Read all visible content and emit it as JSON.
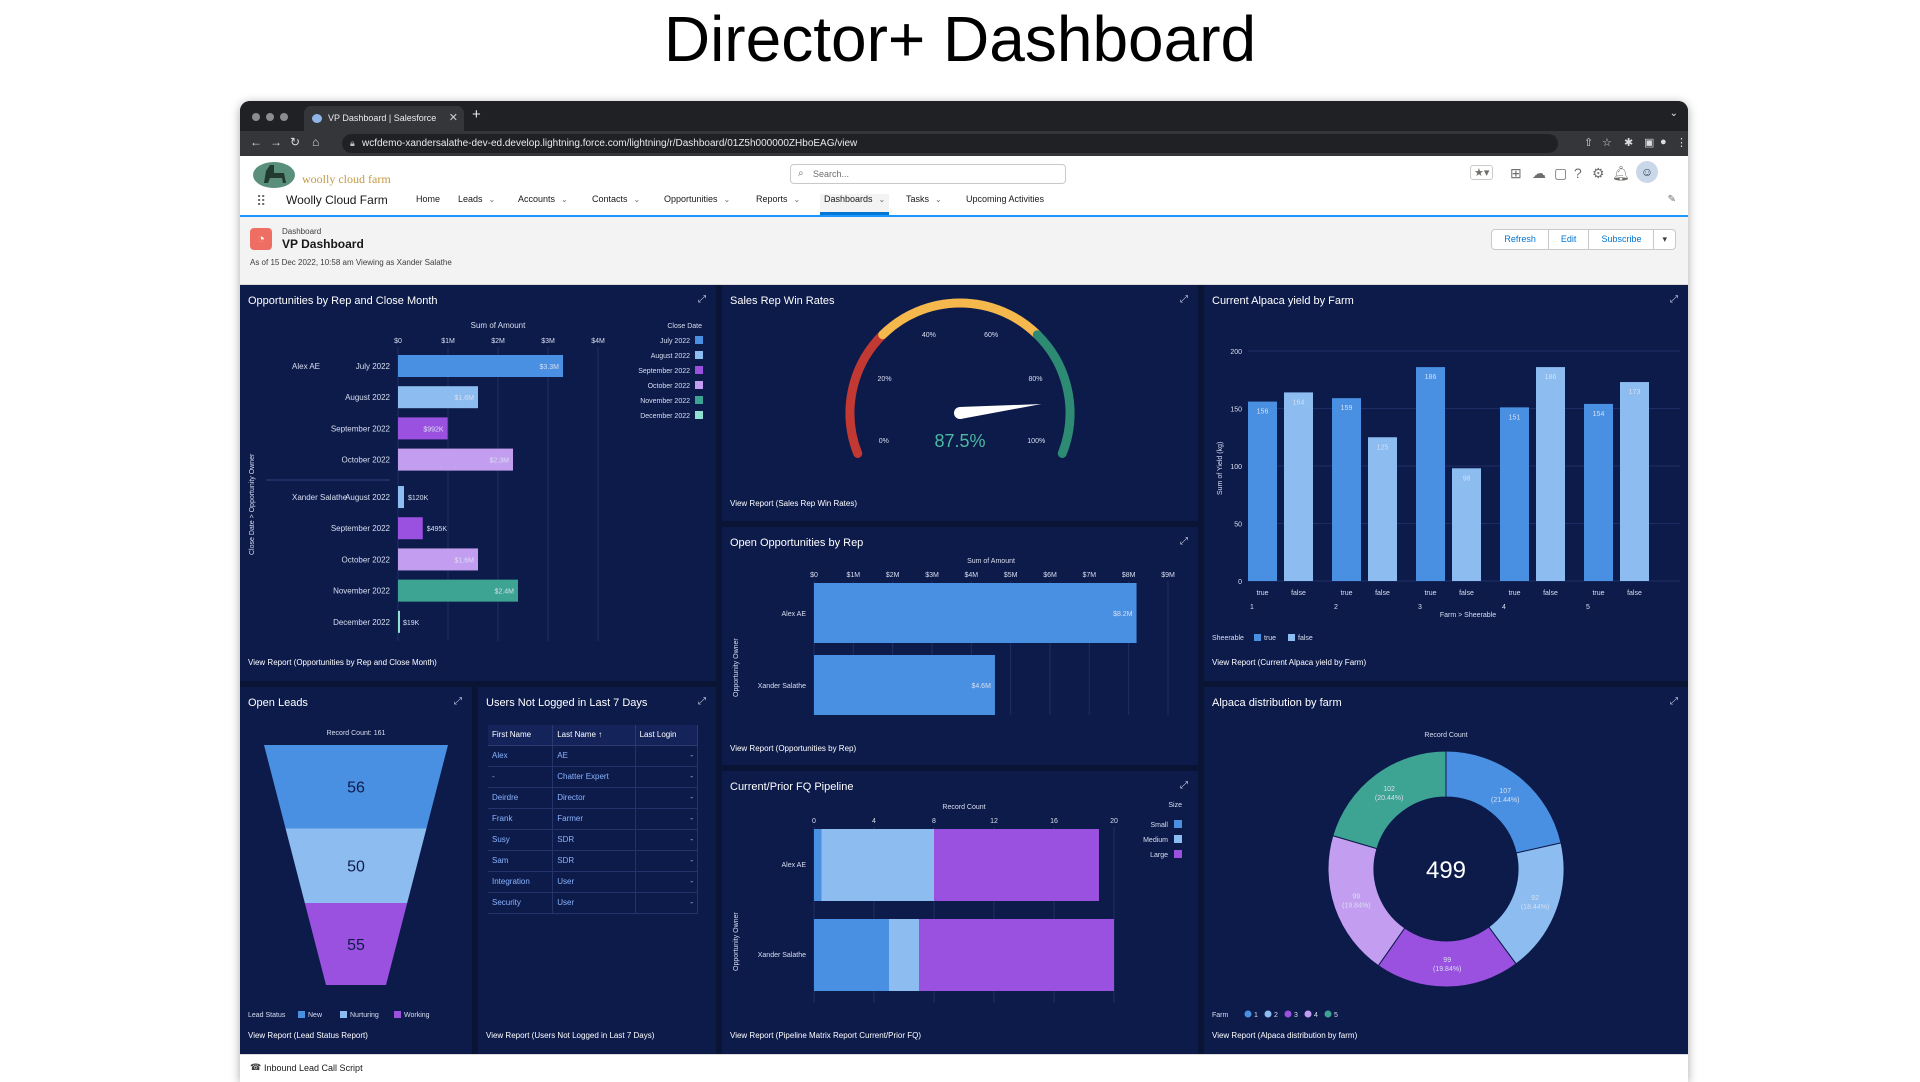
{
  "slide_title": "Director+ Dashboard",
  "browser": {
    "tab_title": "VP Dashboard | Salesforce",
    "new_tab": "+",
    "url": "wcfdemo-xandersalathe-dev-ed.develop.lightning.force.com/lightning/r/Dashboard/01Z5h000000ZHboEAG/view"
  },
  "header": {
    "logo_text": "woolly cloud farm",
    "search_placeholder": "Search...",
    "app_name": "Woolly Cloud Farm",
    "nav": [
      {
        "label": "Home",
        "chevron": false,
        "active": false
      },
      {
        "label": "Leads",
        "chevron": true,
        "active": false
      },
      {
        "label": "Accounts",
        "chevron": true,
        "active": false
      },
      {
        "label": "Contacts",
        "chevron": true,
        "active": false
      },
      {
        "label": "Opportunities",
        "chevron": true,
        "active": false
      },
      {
        "label": "Reports",
        "chevron": true,
        "active": false
      },
      {
        "label": "Dashboards",
        "chevron": true,
        "active": true
      },
      {
        "label": "Tasks",
        "chevron": true,
        "active": false
      },
      {
        "label": "Upcoming Activities",
        "chevron": false,
        "active": false
      }
    ]
  },
  "dashboard": {
    "type_label": "Dashboard",
    "title": "VP Dashboard",
    "as_of": "As of 15 Dec 2022, 10:58 am Viewing as Xander Salathe",
    "actions": [
      "Refresh",
      "Edit",
      "Subscribe"
    ]
  },
  "widgets": {
    "opps_rep_month": {
      "title": "Opportunities by Rep and Close Month",
      "view_report": "View Report (Opportunities by Rep and Close Month)",
      "axis_title": "Sum of Amount",
      "legend_title": "Close Date",
      "y_axis_label": "Close Date > Opportunity Owner"
    },
    "win_rates": {
      "title": "Sales Rep Win Rates",
      "view_report": "View Report (Sales Rep Win Rates)",
      "value_label": "87.5%"
    },
    "alpaca_yield": {
      "title": "Current Alpaca yield by Farm",
      "view_report": "View Report (Current Alpaca yield by Farm)",
      "x_axis_label": "Farm > Sheerable",
      "y_axis_label": "Sum of Yield (kg)",
      "legend_title": "Sheerable"
    },
    "open_opps": {
      "title": "Open Opportunities by Rep",
      "view_report": "View Report (Opportunities by Rep)",
      "axis_title": "Sum of Amount",
      "y_axis_label": "Opportunity Owner"
    },
    "open_leads": {
      "title": "Open Leads",
      "view_report": "View Report (Lead Status Report)",
      "record_count": "Record Count: 161",
      "legend_title": "Lead Status"
    },
    "users_not_logged": {
      "title": "Users Not Logged in Last 7 Days",
      "view_report": "View Report (Users Not Logged in Last 7 Days)",
      "columns": [
        "First Name",
        "Last Name ↑",
        "Last Login"
      ],
      "rows": [
        [
          "Alex",
          "AE",
          "-"
        ],
        [
          "-",
          "Chatter Expert",
          "-"
        ],
        [
          "Deirdre",
          "Director",
          "-"
        ],
        [
          "Frank",
          "Farmer",
          "-"
        ],
        [
          "Susy",
          "SDR",
          "-"
        ],
        [
          "Sam",
          "SDR",
          "-"
        ],
        [
          "Integration",
          "User",
          "-"
        ],
        [
          "Security",
          "User",
          "-"
        ]
      ]
    },
    "pipeline": {
      "title": "Current/Prior FQ Pipeline",
      "view_report": "View Report (Pipeline Matrix Report Current/Prior FQ)",
      "axis_title": "Record Count",
      "legend_title": "Size",
      "y_axis_label": "Opportunity Owner"
    },
    "alpaca_dist": {
      "title": "Alpaca distribution by farm",
      "view_report": "View Report (Alpaca distribution by farm)",
      "axis_title": "Record Count",
      "legend_title": "Farm",
      "total": "499"
    }
  },
  "utility_bar": {
    "label": "Inbound Lead Call Script"
  },
  "chart_data": [
    {
      "id": "opps_rep_month",
      "type": "bar",
      "orientation": "horizontal",
      "xlim": [
        0,
        4
      ],
      "x_ticks": [
        "$0",
        "$1M",
        "$2M",
        "$3M",
        "$4M"
      ],
      "legend": [
        "July 2022",
        "August 2022",
        "September 2022",
        "October 2022",
        "November 2022",
        "December 2022"
      ],
      "colors": {
        "July 2022": "#4a90e2",
        "August 2022": "#8cbcf0",
        "September 2022": "#9b51e0",
        "October 2022": "#c39ef0",
        "November 2022": "#3da392",
        "December 2022": "#8fe0d0"
      },
      "rows": [
        {
          "group": "Alex AE",
          "month": "July 2022",
          "value": 3.3,
          "label": "$3.3M"
        },
        {
          "group": "",
          "month": "August 2022",
          "value": 1.6,
          "label": "$1.6M"
        },
        {
          "group": "",
          "month": "September 2022",
          "value": 0.992,
          "label": "$992K"
        },
        {
          "group": "",
          "month": "October 2022",
          "value": 2.3,
          "label": "$2.3M"
        },
        {
          "group": "Xander Salathe",
          "month": "August 2022",
          "value": 0.12,
          "label": "$120K"
        },
        {
          "group": "",
          "month": "September 2022",
          "value": 0.495,
          "label": "$495K"
        },
        {
          "group": "",
          "month": "October 2022",
          "value": 1.6,
          "label": "$1.6M"
        },
        {
          "group": "",
          "month": "November 2022",
          "value": 2.4,
          "label": "$2.4M"
        },
        {
          "group": "",
          "month": "December 2022",
          "value": 0.019,
          "label": "$19K"
        }
      ]
    },
    {
      "id": "win_rates",
      "type": "gauge",
      "value": 87.5,
      "range": [
        0,
        100
      ],
      "ticks": [
        "0%",
        "20%",
        "40%",
        "60%",
        "80%",
        "100%"
      ],
      "bands": [
        {
          "from": 0,
          "to": 30,
          "color": "#c23934"
        },
        {
          "from": 30,
          "to": 70,
          "color": "#f5b84d"
        },
        {
          "from": 70,
          "to": 100,
          "color": "#2e8b73"
        }
      ]
    },
    {
      "id": "alpaca_yield",
      "type": "bar",
      "ylim": [
        0,
        200
      ],
      "y_ticks": [
        0,
        50,
        100,
        150,
        200
      ],
      "legend": [
        "true",
        "false"
      ],
      "colors": {
        "true": "#4a90e2",
        "false": "#8cbcf0"
      },
      "groups": [
        {
          "farm": "1",
          "bars": [
            {
              "sheerable": "true",
              "value": 156
            },
            {
              "sheerable": "false",
              "value": 164
            }
          ]
        },
        {
          "farm": "2",
          "bars": [
            {
              "sheerable": "true",
              "value": 159
            },
            {
              "sheerable": "false",
              "value": 125
            }
          ]
        },
        {
          "farm": "3",
          "bars": [
            {
              "sheerable": "true",
              "value": 186
            },
            {
              "sheerable": "false",
              "value": 98
            }
          ]
        },
        {
          "farm": "4",
          "bars": [
            {
              "sheerable": "true",
              "value": 151
            },
            {
              "sheerable": "false",
              "value": 186
            }
          ]
        },
        {
          "farm": "5",
          "bars": [
            {
              "sheerable": "true",
              "value": 154
            },
            {
              "sheerable": "false",
              "value": 173
            }
          ]
        }
      ]
    },
    {
      "id": "open_opps",
      "type": "bar",
      "orientation": "horizontal",
      "xlim": [
        0,
        9
      ],
      "x_ticks": [
        "$0",
        "$1M",
        "$2M",
        "$3M",
        "$4M",
        "$5M",
        "$6M",
        "$7M",
        "$8M",
        "$9M"
      ],
      "color": "#4a90e2",
      "rows": [
        {
          "label": "Alex AE",
          "value": 8.2,
          "value_label": "$8.2M"
        },
        {
          "label": "Xander Salathe",
          "value": 4.6,
          "value_label": "$4.6M"
        }
      ]
    },
    {
      "id": "open_leads",
      "type": "funnel",
      "legend": [
        "New",
        "Nurturing",
        "Working"
      ],
      "colors": {
        "New": "#4a90e2",
        "Nurturing": "#8cbcf0",
        "Working": "#9b51e0"
      },
      "stages": [
        {
          "status": "New",
          "value": 56
        },
        {
          "status": "Nurturing",
          "value": 50
        },
        {
          "status": "Working",
          "value": 55
        }
      ]
    },
    {
      "id": "pipeline",
      "type": "bar",
      "orientation": "horizontal",
      "stacked": true,
      "xlim": [
        0,
        20
      ],
      "x_ticks": [
        0,
        4,
        8,
        12,
        16,
        20
      ],
      "legend": [
        "Small",
        "Medium",
        "Large"
      ],
      "colors": {
        "Small": "#4a90e2",
        "Medium": "#8cbcf0",
        "Large": "#9b51e0"
      },
      "rows": [
        {
          "label": "Alex AE",
          "values": {
            "Small": 0.5,
            "Medium": 7.5,
            "Large": 11
          }
        },
        {
          "label": "Xander Salathe",
          "values": {
            "Small": 5,
            "Medium": 2,
            "Large": 13
          }
        }
      ]
    },
    {
      "id": "alpaca_dist",
      "type": "pie",
      "donut": true,
      "total": 499,
      "legend": [
        "1",
        "2",
        "3",
        "4",
        "5"
      ],
      "slices": [
        {
          "farm": "1",
          "value": 107,
          "percent": "21.44%",
          "color": "#4a90e2"
        },
        {
          "farm": "2",
          "value": 92,
          "percent": "18.44%",
          "color": "#8cbcf0"
        },
        {
          "farm": "3",
          "value": 99,
          "percent": "19.84%",
          "color": "#9b51e0"
        },
        {
          "farm": "4",
          "value": 99,
          "percent": "19.84%",
          "color": "#c39ef0"
        },
        {
          "farm": "5",
          "value": 102,
          "percent": "20.44%",
          "color": "#3da392"
        }
      ]
    }
  ]
}
